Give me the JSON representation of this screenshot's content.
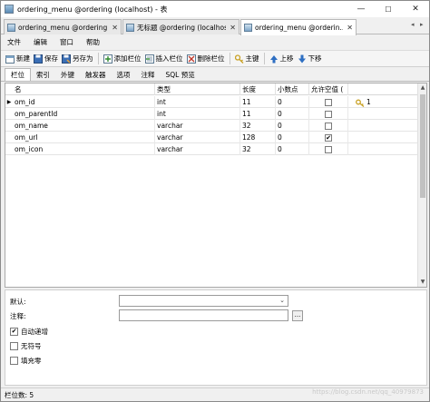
{
  "window": {
    "title": "ordering_menu @ordering (localhost) - 表",
    "controls": {
      "minimize": "—",
      "maximize": "☐",
      "close": "✕"
    }
  },
  "doc_tabs": [
    {
      "label": "ordering_menu @ordering (localhost)",
      "close": "✕",
      "active": false
    },
    {
      "label": "无标题 @ordering (localhost)",
      "close": "✕",
      "active": false
    },
    {
      "label": "ordering_menu @orderin...",
      "close": "✕",
      "active": true
    }
  ],
  "tab_scroll": {
    "left": "◂",
    "right": "▸"
  },
  "menu": [
    "文件",
    "编辑",
    "窗口",
    "帮助"
  ],
  "toolbar": {
    "new": "新建",
    "save": "保存",
    "save_as": "另存为",
    "add_field": "添加栏位",
    "insert_field": "插入栏位",
    "delete_field": "删除栏位",
    "primary_key": "主键",
    "move_up": "上移",
    "move_down": "下移"
  },
  "sub_tabs": [
    "栏位",
    "索引",
    "外键",
    "触发器",
    "选项",
    "注释",
    "SQL 预览"
  ],
  "grid": {
    "headers": [
      "名",
      "类型",
      "长度",
      "小数点",
      "允许空值 (",
      ""
    ],
    "rows": [
      {
        "name": "om_id",
        "type": "int",
        "length": "11",
        "decimals": "0",
        "nullable": false,
        "key": "1",
        "current": true
      },
      {
        "name": "om_parentId",
        "type": "int",
        "length": "11",
        "decimals": "0",
        "nullable": false,
        "key": "",
        "current": false
      },
      {
        "name": "om_name",
        "type": "varchar",
        "length": "32",
        "decimals": "0",
        "nullable": false,
        "key": "",
        "current": false
      },
      {
        "name": "om_url",
        "type": "varchar",
        "length": "128",
        "decimals": "0",
        "nullable": true,
        "key": "",
        "current": false
      },
      {
        "name": "om_icon",
        "type": "varchar",
        "length": "32",
        "decimals": "0",
        "nullable": false,
        "key": "",
        "current": false
      }
    ]
  },
  "properties": {
    "default_label": "默认:",
    "comment_label": "注释:",
    "ellipsis": "...",
    "auto_increment_label": "自动递增",
    "auto_increment_checked": true,
    "unsigned_label": "无符号",
    "unsigned_checked": false,
    "zerofill_label": "填充零",
    "zerofill_checked": false
  },
  "status": {
    "field_count": "栏位数: 5"
  },
  "watermark": "https://blog.csdn.net/qq_40979873",
  "colors": {
    "window_bg": "#f0f0f0",
    "grid_bg": "#ffffff",
    "border": "#a9a9a9",
    "key_icon": "#c9a227"
  }
}
